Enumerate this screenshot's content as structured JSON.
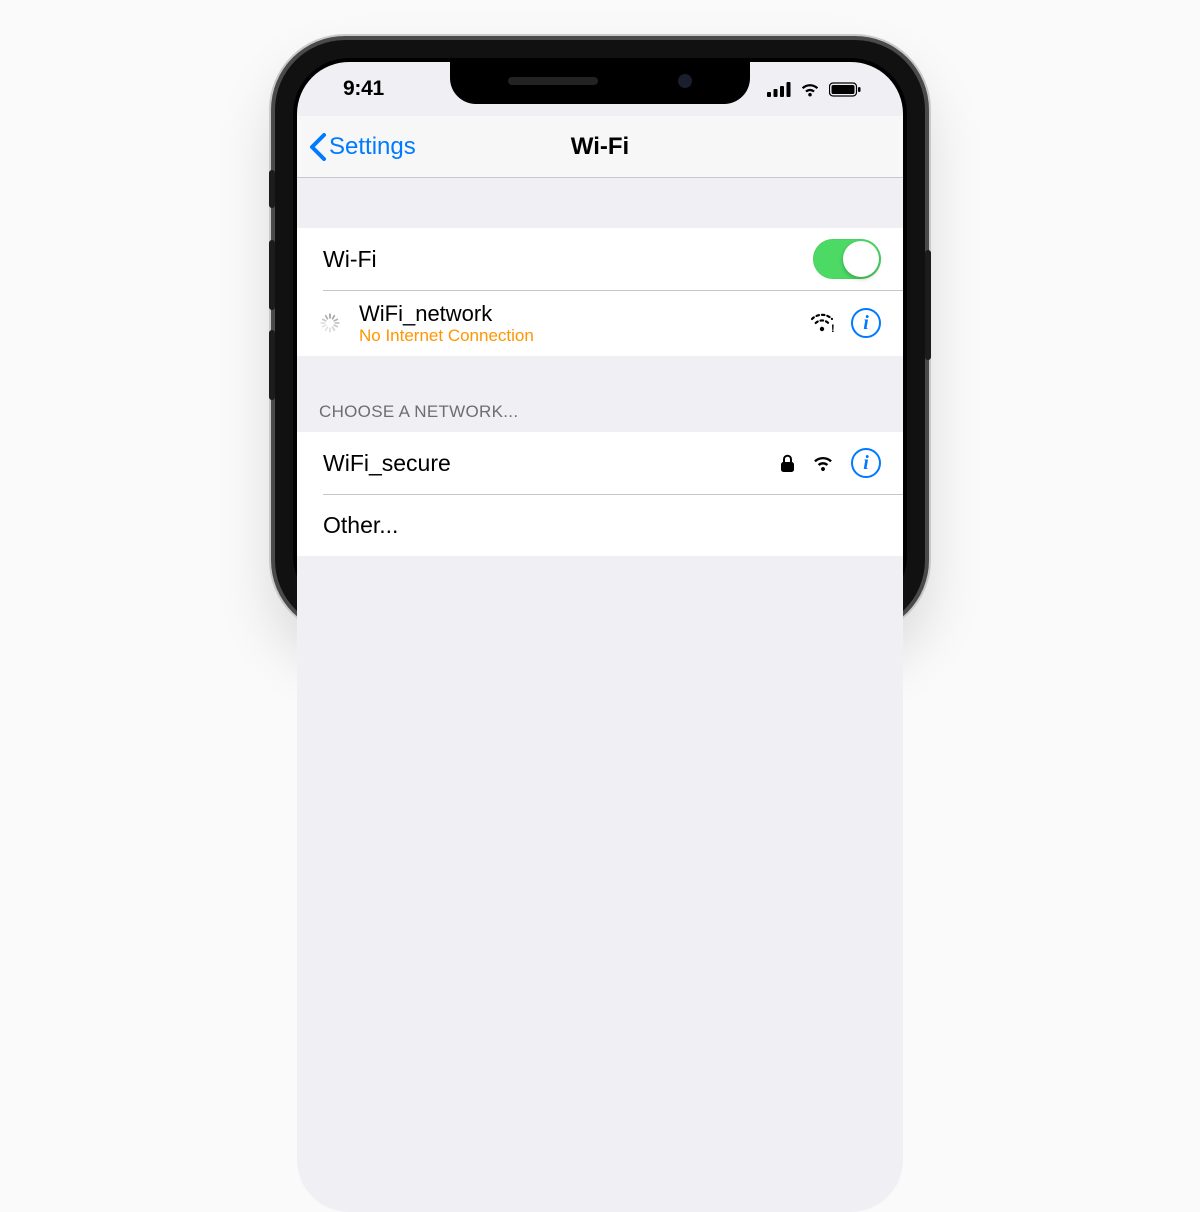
{
  "status": {
    "time": "9:41"
  },
  "nav": {
    "back_label": "Settings",
    "title": "Wi-Fi"
  },
  "wifi_row": {
    "label": "Wi-Fi",
    "enabled": true
  },
  "connected": {
    "name": "WiFi_network",
    "status": "No Internet Connection"
  },
  "section_header": "CHOOSE A NETWORK...",
  "networks": [
    {
      "name": "WiFi_secure",
      "secure": true
    }
  ],
  "other_label": "Other...",
  "info_glyph": "i",
  "colors": {
    "link": "#007aff",
    "warning": "#ff9500",
    "toggle_on": "#4cd964",
    "cell_bg": "#ffffff",
    "group_bg": "#efeff4"
  }
}
